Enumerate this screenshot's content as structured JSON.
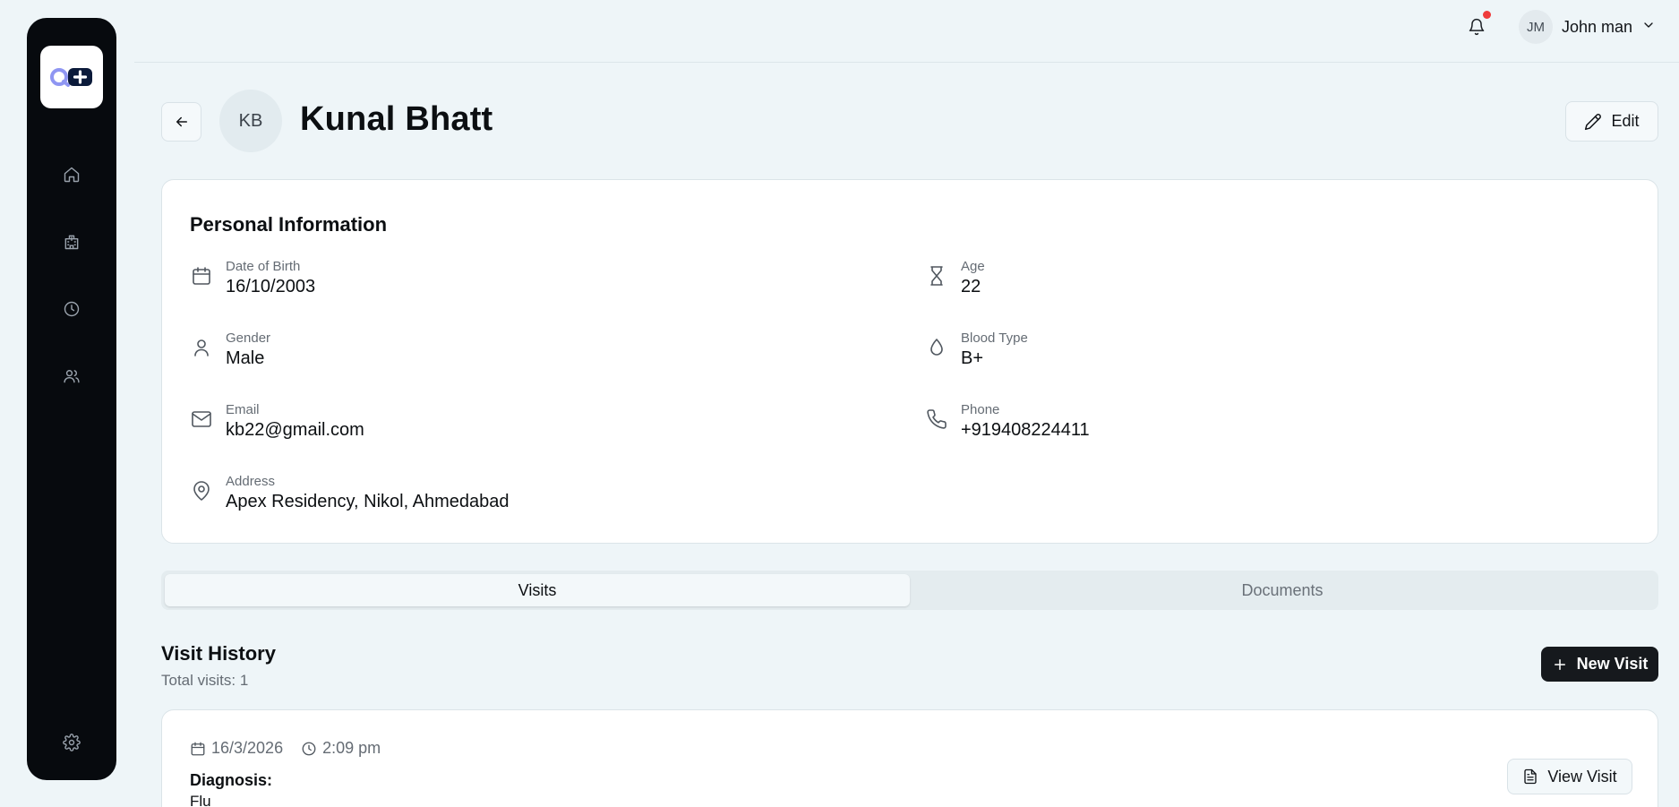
{
  "header": {
    "notification_icon": "bell-icon",
    "has_notification": true,
    "user": {
      "initials": "JM",
      "name": "John man"
    }
  },
  "sidebar": {
    "items": [
      {
        "icon": "home-icon"
      },
      {
        "icon": "hospital-icon"
      },
      {
        "icon": "clock-icon"
      },
      {
        "icon": "users-icon"
      },
      {
        "icon": "gear-icon"
      }
    ]
  },
  "patient": {
    "initials": "KB",
    "name": "Kunal Bhatt",
    "edit_label": "Edit"
  },
  "personal_info": {
    "title": "Personal Information",
    "fields": [
      {
        "label": "Date of Birth",
        "value": "16/10/2003",
        "icon": "calendar-icon"
      },
      {
        "label": "Age",
        "value": "22",
        "icon": "hourglass-icon"
      },
      {
        "label": "Gender",
        "value": "Male",
        "icon": "user-icon"
      },
      {
        "label": "Blood Type",
        "value": "B+",
        "icon": "droplet-icon"
      },
      {
        "label": "Email",
        "value": "kb22@gmail.com",
        "icon": "mail-icon"
      },
      {
        "label": "Phone",
        "value": "+919408224411",
        "icon": "phone-icon"
      },
      {
        "label": "Address",
        "value": "Apex Residency, Nikol, Ahmedabad",
        "icon": "map-pin-icon"
      }
    ]
  },
  "tabs": [
    {
      "label": "Visits",
      "active": true
    },
    {
      "label": "Documents",
      "active": false
    }
  ],
  "visit_history": {
    "title": "Visit History",
    "total": "Total visits: 1",
    "new_visit_label": "New Visit",
    "visits": [
      {
        "date": "16/3/2026",
        "time": "2:09 pm",
        "diagnosis_label": "Diagnosis:",
        "diagnosis": "Flu",
        "view_label": "View Visit"
      }
    ]
  },
  "colors": {
    "background": "#eef5f8",
    "sidebar": "#070a0e",
    "primary_button": "#16191d",
    "notification_dot": "#ef3b3b"
  }
}
